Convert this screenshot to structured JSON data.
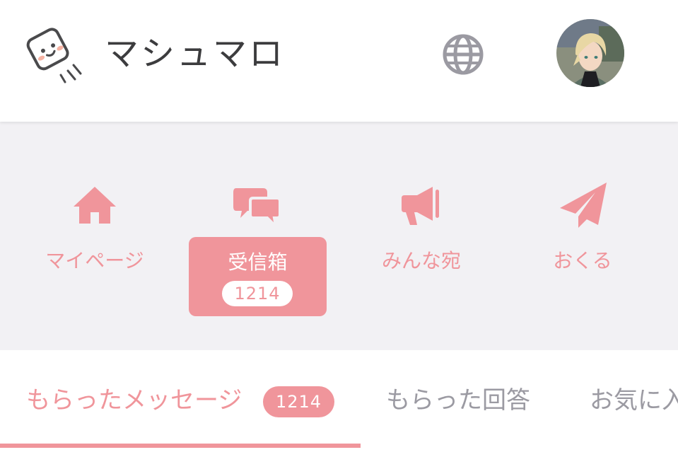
{
  "header": {
    "brand": "マシュマロ",
    "logo_icon": "marshmallow-logo-icon",
    "language_icon": "globe-icon",
    "avatar": "user-avatar"
  },
  "nav": {
    "items": [
      {
        "label": "マイページ",
        "icon": "home-icon"
      },
      {
        "label": "受信箱",
        "icon": "chat-bubbles-icon",
        "badge": "1214",
        "active": true
      },
      {
        "label": "みんな宛",
        "icon": "megaphone-icon"
      },
      {
        "label": "おくる",
        "icon": "paper-plane-icon"
      }
    ]
  },
  "tabs": {
    "items": [
      {
        "label": "もらったメッセージ",
        "badge": "1214",
        "active": true
      },
      {
        "label": "もらった回答"
      },
      {
        "label": "お気に入"
      }
    ]
  },
  "colors": {
    "accent": "#f0959b",
    "nav_bg": "#f2f1f4",
    "inactive_text": "#9b9aa2",
    "brand_text": "#3c3c3e"
  }
}
